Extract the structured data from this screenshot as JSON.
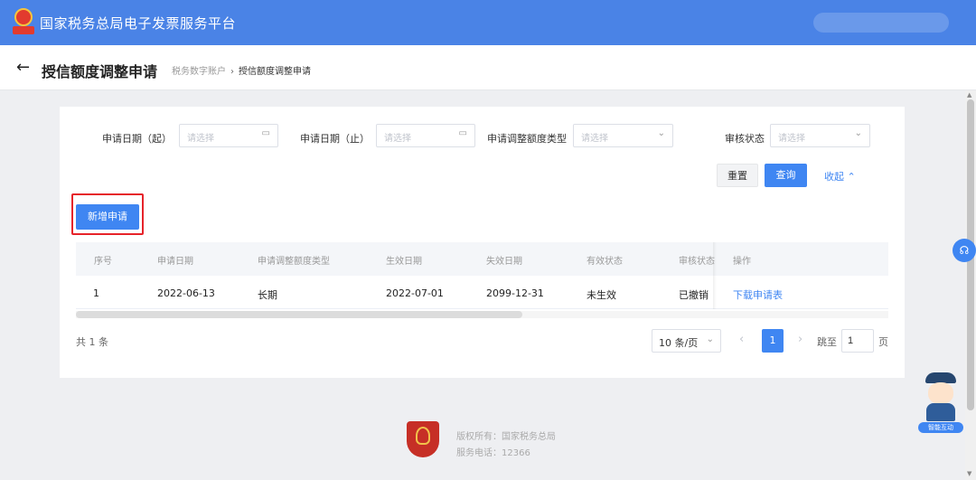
{
  "header": {
    "app_title": "国家税务总局电子发票服务平台"
  },
  "titlebar": {
    "page_title": "授信额度调整申请",
    "breadcrumb": [
      "税务数字账户",
      "授信额度调整申请"
    ],
    "breadcrumb_separator": "›"
  },
  "filters": {
    "start_date": {
      "label": "申请日期（起）",
      "placeholder": "请选择"
    },
    "end_date": {
      "label": "申请日期（止）",
      "placeholder": "请选择"
    },
    "adjust_type": {
      "label": "申请调整额度类型",
      "placeholder": "请选择"
    },
    "review_status": {
      "label": "审核状态",
      "placeholder": "请选择"
    }
  },
  "actions": {
    "reset": "重置",
    "query": "查询",
    "collapse": "收起",
    "new_application": "新增申请"
  },
  "table": {
    "columns": [
      "序号",
      "申请日期",
      "申请调整额度类型",
      "生效日期",
      "失效日期",
      "有效状态",
      "审核状态",
      "操作"
    ],
    "rows": [
      {
        "index": "1",
        "apply_date": "2022-06-13",
        "type": "长期",
        "effective_date": "2022-07-01",
        "expiry_date": "2099-12-31",
        "valid_status": "未生效",
        "review_status": "已撤销",
        "action": "下载申请表"
      }
    ]
  },
  "pagination": {
    "total": "共 1 条",
    "page_size": "10 条/页",
    "current_page": "1",
    "goto_label": "跳至",
    "goto_value": "1",
    "goto_suffix": "页"
  },
  "footer": {
    "copyright": "版权所有：国家税务总局",
    "phone": "服务电话：12366"
  },
  "mascot": {
    "label": "智能互动"
  },
  "icons": {
    "back": "arrow-left-icon",
    "calendar": "calendar-icon",
    "dropdown": "chevron-down-icon",
    "collapse": "chevron-up-icon",
    "support": "headset-icon"
  },
  "colors": {
    "header": "#4a83e6",
    "primary": "#3f86f2",
    "highlight": "#e6232a"
  }
}
